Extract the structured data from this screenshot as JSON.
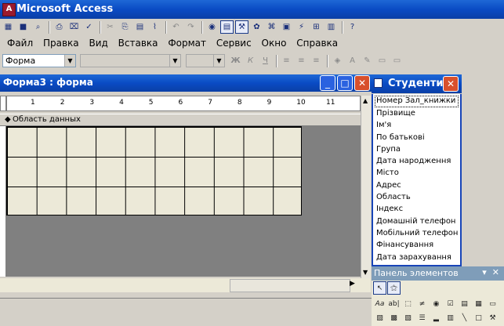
{
  "app": {
    "title": "Microsoft Access",
    "logo_letter": "A"
  },
  "menu": [
    "Файл",
    "Правка",
    "Вид",
    "Вставка",
    "Формат",
    "Сервис",
    "Окно",
    "Справка"
  ],
  "format_bar": {
    "object_combo": "Форма",
    "bold": "Ж",
    "italic": "К",
    "underline": "Ч"
  },
  "form_window": {
    "title": "Форма3 : форма",
    "ruler_ticks": [
      "1",
      "2",
      "3",
      "4",
      "5",
      "6",
      "7",
      "8",
      "9",
      "10",
      "11"
    ],
    "section_label": "Область данных"
  },
  "field_list": {
    "title": "Студенти",
    "fields": [
      "Номер Зал_книжки",
      "Прізвище",
      "Ім'я",
      "По батькові",
      "Група",
      "Дата народження",
      "Місто",
      "Адрес",
      "Область",
      "Індекс",
      "Домашній телефон",
      "Мобільний телефон",
      "Фінансування",
      "Дата зарахування"
    ],
    "selected_index": 0
  },
  "toolbox": {
    "title": "Панель элементов",
    "label_tool": "Aa",
    "textbox_tool": "ab|"
  },
  "colors": {
    "titlebar": "#0a4bc4",
    "close": "#d8502c",
    "chrome": "#d4d0c8",
    "form_grid": "#ece9d8"
  }
}
